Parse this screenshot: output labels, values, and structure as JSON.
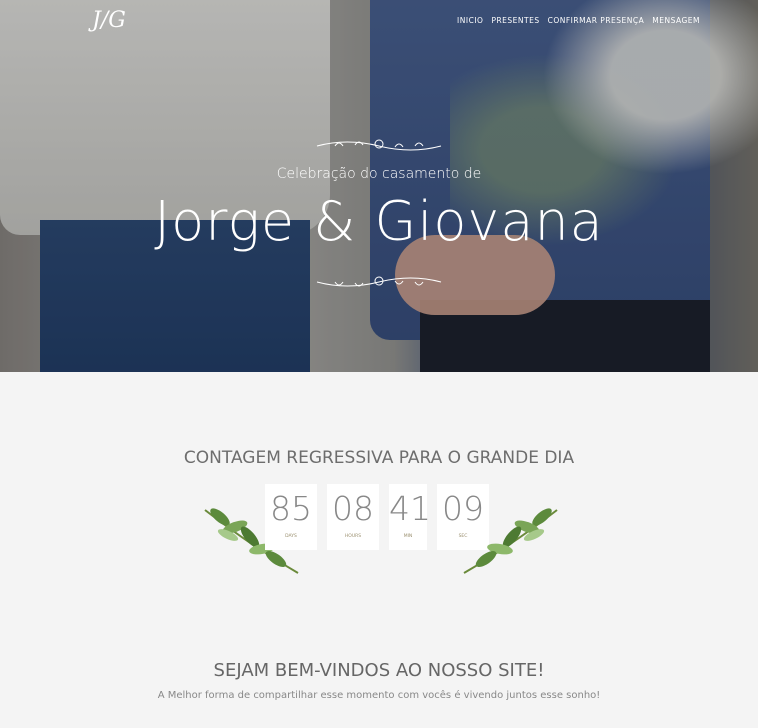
{
  "logo": "J/G",
  "nav": [
    "INICIO",
    "PRESENTES",
    "CONFIRMAR PRESENÇA",
    "MENSAGEM"
  ],
  "hero": {
    "subtitle": "Celebração do casamento de",
    "names": "Jorge & Giovana"
  },
  "countdown": {
    "title": "CONTAGEM REGRESSIVA PARA O GRANDE DIA",
    "units": [
      {
        "value": "85",
        "label": "DAYS"
      },
      {
        "value": "08",
        "label": "HOURS"
      },
      {
        "value": "41",
        "label": "MIN"
      },
      {
        "value": "09",
        "label": "SEC"
      }
    ]
  },
  "welcome": {
    "title": "SEJAM BEM-VINDOS AO NOSSO SITE!",
    "text": "A Melhor forma de compartilhar esse momento com vocês é vivendo juntos esse sonho!"
  },
  "colors": {
    "accent": "#9a8f6e",
    "background": "#f4f4f4"
  }
}
